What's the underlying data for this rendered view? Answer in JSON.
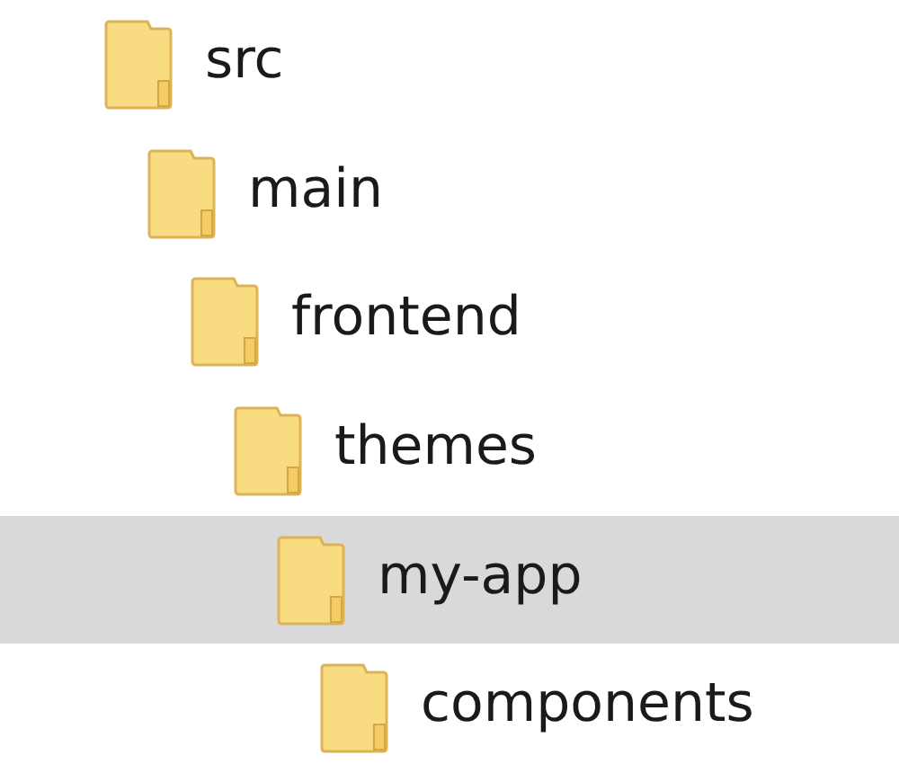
{
  "tree": [
    {
      "label": "src",
      "selected": false,
      "children": [
        {
          "label": "main",
          "selected": false,
          "children": [
            {
              "label": "frontend",
              "selected": false,
              "children": [
                {
                  "label": "themes",
                  "selected": false,
                  "children": [
                    {
                      "label": "my-app",
                      "selected": true,
                      "children": [
                        {
                          "label": "components",
                          "selected": false
                        }
                      ]
                    }
                  ]
                }
              ]
            }
          ]
        }
      ]
    }
  ]
}
